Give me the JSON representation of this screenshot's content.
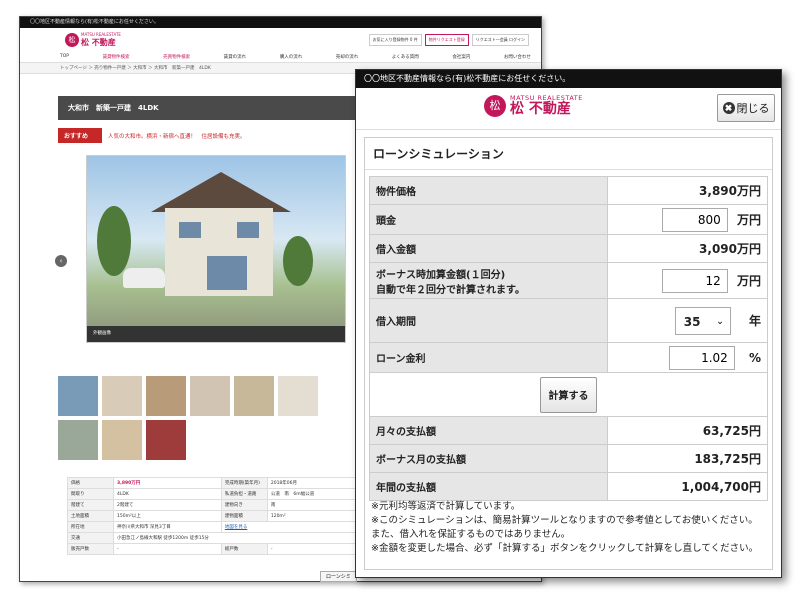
{
  "background_page": {
    "top_bar": "〇〇地区不動産情報なら(有)松不動産にお任せください。",
    "logo": {
      "en": "MATSU REALESTATE",
      "jp": "松 不動産",
      "mark": "松"
    },
    "header_links": [
      "お気に入り登録物件 0 件",
      "物件リクエスト登録",
      "リクエスト一会員 ログイン"
    ],
    "nav": [
      "TOP",
      "賃貸物件検索",
      "売買物件検索",
      "賃貸の流れ",
      "購入の流れ",
      "売却の流れ",
      "よくある質問",
      "会社案内",
      "お問い合わせ"
    ],
    "breadcrumb": "トップページ ＞ 売り物件一戸建 ＞ 大和市 ＞ 大和市　新築一戸建　4LDK",
    "title": "大和市　新築一戸建　4LDK",
    "recommend": {
      "tag": "おすすめ",
      "text": "人気の大和市。横浜・新宿へ直通！　住居設備も充実。"
    },
    "photo_caption": "外観画像",
    "arrow": "‹",
    "thumb_colors": [
      "#7a9bb8",
      "#d8cbb8",
      "#b89b78",
      "#d2c4b2",
      "#c8b89a",
      "#e3ddd2",
      "#9aa89a",
      "#d4c1a1",
      "#9e3b3b"
    ],
    "details": [
      [
        "価格",
        "3,890万円",
        "完成時期(築年月)",
        "2018年06月"
      ],
      [
        "間取り",
        "4LDK",
        "私道負担・道路",
        "公道　南　6m幅公道"
      ],
      [
        "階建て",
        "2階建て",
        "建物向き",
        "南"
      ],
      [
        "土地面積",
        "150m²以上",
        "建物面積",
        "120m²"
      ],
      [
        "所在地",
        "神奈川県大和市 深見3丁目",
        "地図を見る",
        ""
      ],
      [
        "交通",
        "小田急江ノ島線大和駅 徒歩1200m 徒歩15分",
        "",
        ""
      ],
      [
        "販売戸数",
        "-",
        "総戸数",
        "-"
      ]
    ],
    "loan_button": "ローンシミ"
  },
  "modal": {
    "top_bar": "〇〇地区不動産情報なら(有)松不動産にお任せください。",
    "logo": {
      "en": "MATSU REALESTATE",
      "jp": "松 不動産",
      "mark": "松"
    },
    "close_label": "閉じる",
    "close_glyph": "✖",
    "panel_title": "ローンシミュレーション",
    "rows": {
      "price": {
        "label": "物件価格",
        "value": "3,890万円"
      },
      "down": {
        "label": "頭金",
        "input": "800",
        "unit": "万円"
      },
      "borrow": {
        "label": "借入金額",
        "value": "3,090万円"
      },
      "bonus": {
        "label_line1": "ボーナス時加算金額(１回分)",
        "label_line2": "自動で年２回分で計算されます。",
        "input": "12",
        "unit": "万円"
      },
      "period": {
        "label": "借入期間",
        "selected": "35",
        "unit": "年",
        "chevron": "⌄"
      },
      "rate": {
        "label": "ローン金利",
        "input": "1.02",
        "unit": "%"
      },
      "calc_button": "計算する",
      "monthly": {
        "label": "月々の支払額",
        "value": "63,725円"
      },
      "bonus_month": {
        "label": "ボーナス月の支払額",
        "value": "183,725円"
      },
      "annual": {
        "label": "年間の支払額",
        "value": "1,004,700円"
      }
    },
    "notes": [
      "※元利均等返済で計算しています。",
      "※このシミュレーションは、簡易計算ツールとなりますので参考値としてお使いください。",
      "また、借入れを保証するものではありません。",
      "※金額を変更した場合、必ず「計算する」ボタンをクリックして計算をし直してください。"
    ]
  }
}
